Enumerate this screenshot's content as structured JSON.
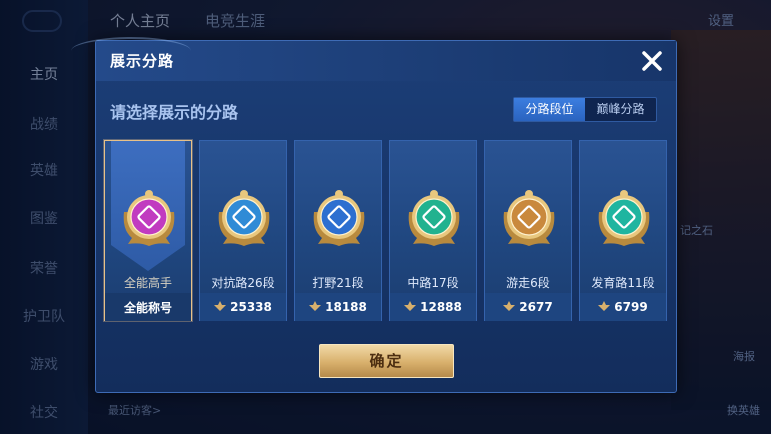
{
  "background": {
    "sidebar_items": [
      "主页",
      "战绩",
      "英雄",
      "图鉴",
      "荣誉",
      "护卫队",
      "游戏",
      "社交"
    ],
    "top_nav": [
      "个人主页",
      "电竞生涯"
    ],
    "right_labels": [
      "设置",
      "海报",
      "换英雄",
      "记之石"
    ],
    "recent_visitors": "最近访客>"
  },
  "modal": {
    "title": "展示分路",
    "subtitle": "请选择展示的分路",
    "toggle": [
      "分路段位",
      "巅峰分路"
    ],
    "confirm_label": "确定",
    "cards": [
      {
        "label": "全能高手",
        "footer": "全能称号",
        "has_points": false,
        "badge_color": "#c13bc0",
        "selected": true
      },
      {
        "label": "对抗路26段",
        "footer": "25338",
        "has_points": true,
        "badge_color": "#2f8bd6",
        "selected": false
      },
      {
        "label": "打野21段",
        "footer": "18188",
        "has_points": true,
        "badge_color": "#2d6fd0",
        "selected": false
      },
      {
        "label": "中路17段",
        "footer": "12888",
        "has_points": true,
        "badge_color": "#22b28f",
        "selected": false
      },
      {
        "label": "游走6段",
        "footer": "2677",
        "has_points": true,
        "badge_color": "#c9893d",
        "selected": false
      },
      {
        "label": "发育路11段",
        "footer": "6799",
        "has_points": true,
        "badge_color": "#1fb5a0",
        "selected": false
      }
    ]
  },
  "colors": {
    "accent_gold": "#e7c189",
    "panel_blue": "#1c3f78"
  }
}
